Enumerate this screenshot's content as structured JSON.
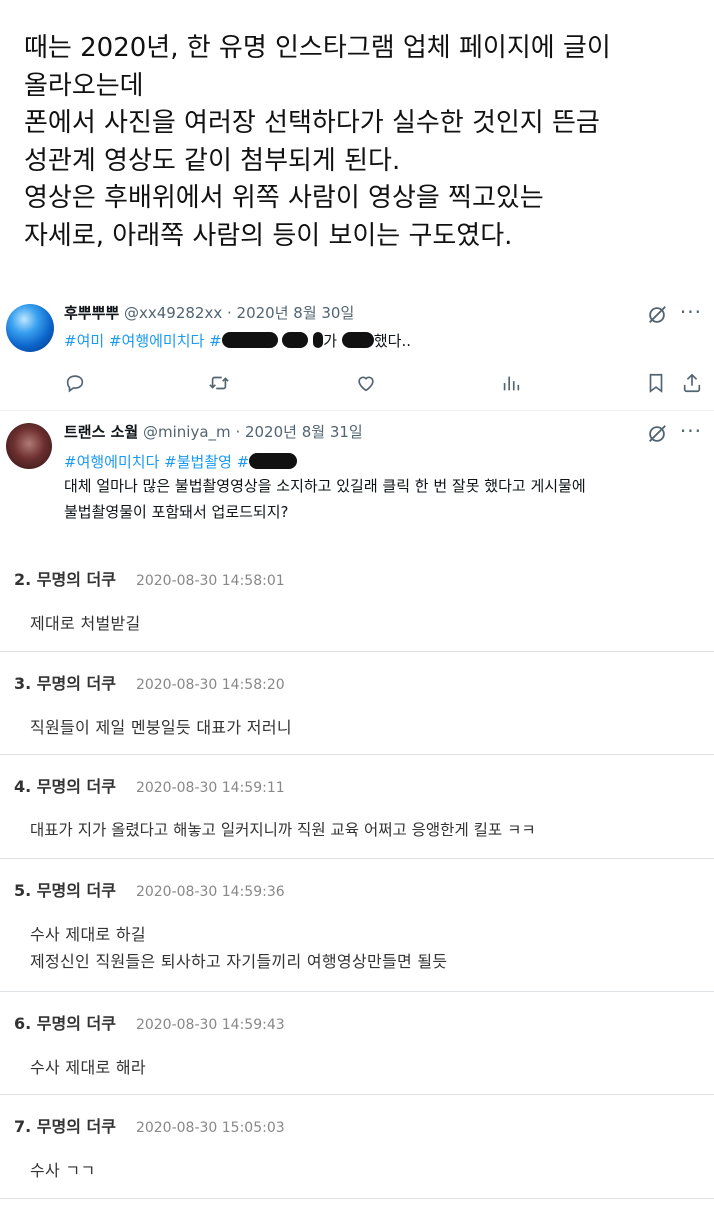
{
  "intro": {
    "lines": [
      "때는 2020년, 한 유명 인스타그램 업체 페이지에 글이",
      "올라오는데",
      "폰에서 사진을 여러장 선택하다가 실수한 것인지 뜬금",
      "성관계 영상도 같이 첨부되게 된다.",
      "영상은 후배위에서 위쪽 사람이 영상을 찍고있는",
      "자세로, 아래쪽 사람의 등이 보이는 구도였다."
    ]
  },
  "tweet1": {
    "name": "후뿌뿌뿌",
    "handle": "@xx49282xx",
    "date": "· 2020년 8월 30일",
    "hashtags": [
      "#여미",
      "#여행에미치다",
      "#"
    ],
    "text_a": "가",
    "text_b": "했다..",
    "avatar_icon": "blue-sphere-avatar",
    "actions": [
      "reply-icon",
      "retweet-icon",
      "like-icon",
      "views-icon",
      "bookmark-icon",
      "share-icon"
    ]
  },
  "tweet2": {
    "name": "트랜스 소월",
    "handle": "@miniya_m",
    "date": "· 2020년 8월 31일",
    "hashtags": [
      "#여행에미치다",
      "#불법촬영",
      "#"
    ],
    "line1": "대체 얼마나 많은 불법촬영영상을 소지하고 있길래 클릭 한 번 잘못 했다고 게시물에",
    "line2": "불법촬영물이 포함돼서 업로드되지?"
  },
  "comments": [
    {
      "num": "2. 무명의 더쿠",
      "date": "2020-08-30 14:58:01",
      "lines": [
        "제대로 처벌받길"
      ]
    },
    {
      "num": "3. 무명의 더쿠",
      "date": "2020-08-30 14:58:20",
      "lines": [
        "직원들이 제일 멘붕일듯 대표가 저러니"
      ]
    },
    {
      "num": "4. 무명의 더쿠",
      "date": "2020-08-30 14:59:11",
      "lines": [
        "대표가 지가 올렸다고 해놓고 일커지니까 직원 교육 어쩌고 응앵한게 킬포 ㅋㅋ"
      ]
    },
    {
      "num": "5. 무명의 더쿠",
      "date": "2020-08-30 14:59:36",
      "lines": [
        "수사 제대로 하길",
        "제정신인 직원들은 퇴사하고 자기들끼리 여행영상만들면 될듯"
      ]
    },
    {
      "num": "6. 무명의 더쿠",
      "date": "2020-08-30 14:59:43",
      "lines": [
        "수사 제대로 해라"
      ]
    },
    {
      "num": "7. 무명의 더쿠",
      "date": "2020-08-30 15:05:03",
      "lines": [
        "수사 ㄱㄱ"
      ]
    }
  ],
  "colors": {
    "link": "#1d9bf0",
    "muted": "#536471",
    "divider": "#dfe2e5"
  }
}
